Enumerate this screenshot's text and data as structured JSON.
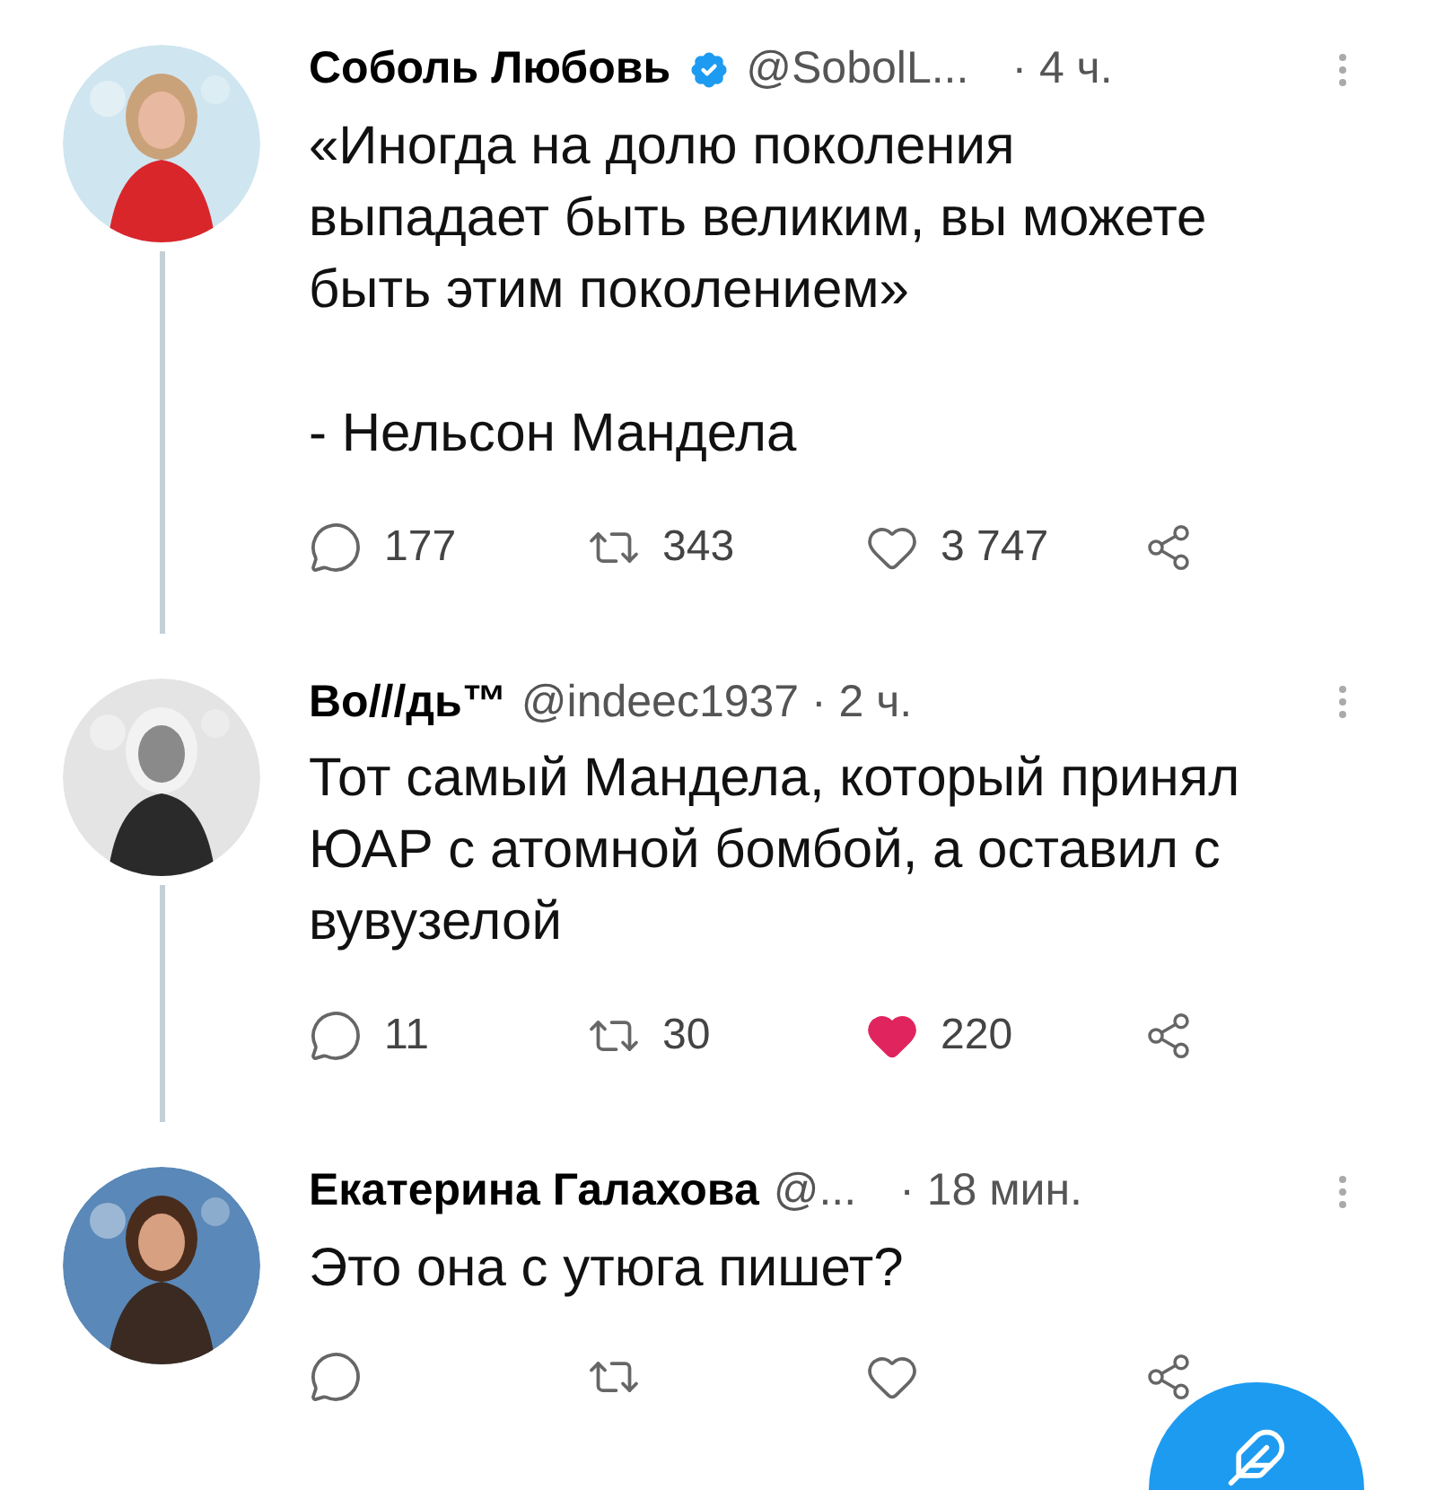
{
  "tweets": [
    {
      "name": "Соболь Любовь",
      "verified": true,
      "handle": "@SobolL...",
      "time": "· 4 ч.",
      "text": "«Иногда на долю поколения выпадает быть великим, вы можете быть этим поколением»\n\n- Нельсон Мандела",
      "replies": "177",
      "retweets": "343",
      "likes": "3 747",
      "liked": false,
      "thread_below": true
    },
    {
      "name": "Во///дь™",
      "verified": false,
      "handle": "@indeec1937 · 2 ч.",
      "text": "Тот самый Мандела, который принял ЮАР с атомной бомбой, а оставил с вувузелой",
      "replies": "11",
      "retweets": "30",
      "likes": "220",
      "liked": true,
      "thread_below": true
    },
    {
      "name": "Екатерина Галахова",
      "verified": false,
      "handle": "@...",
      "time": "· 18 мин.",
      "text": "Это она с утюга пишет?",
      "liked": false,
      "thread_below": false
    }
  ]
}
